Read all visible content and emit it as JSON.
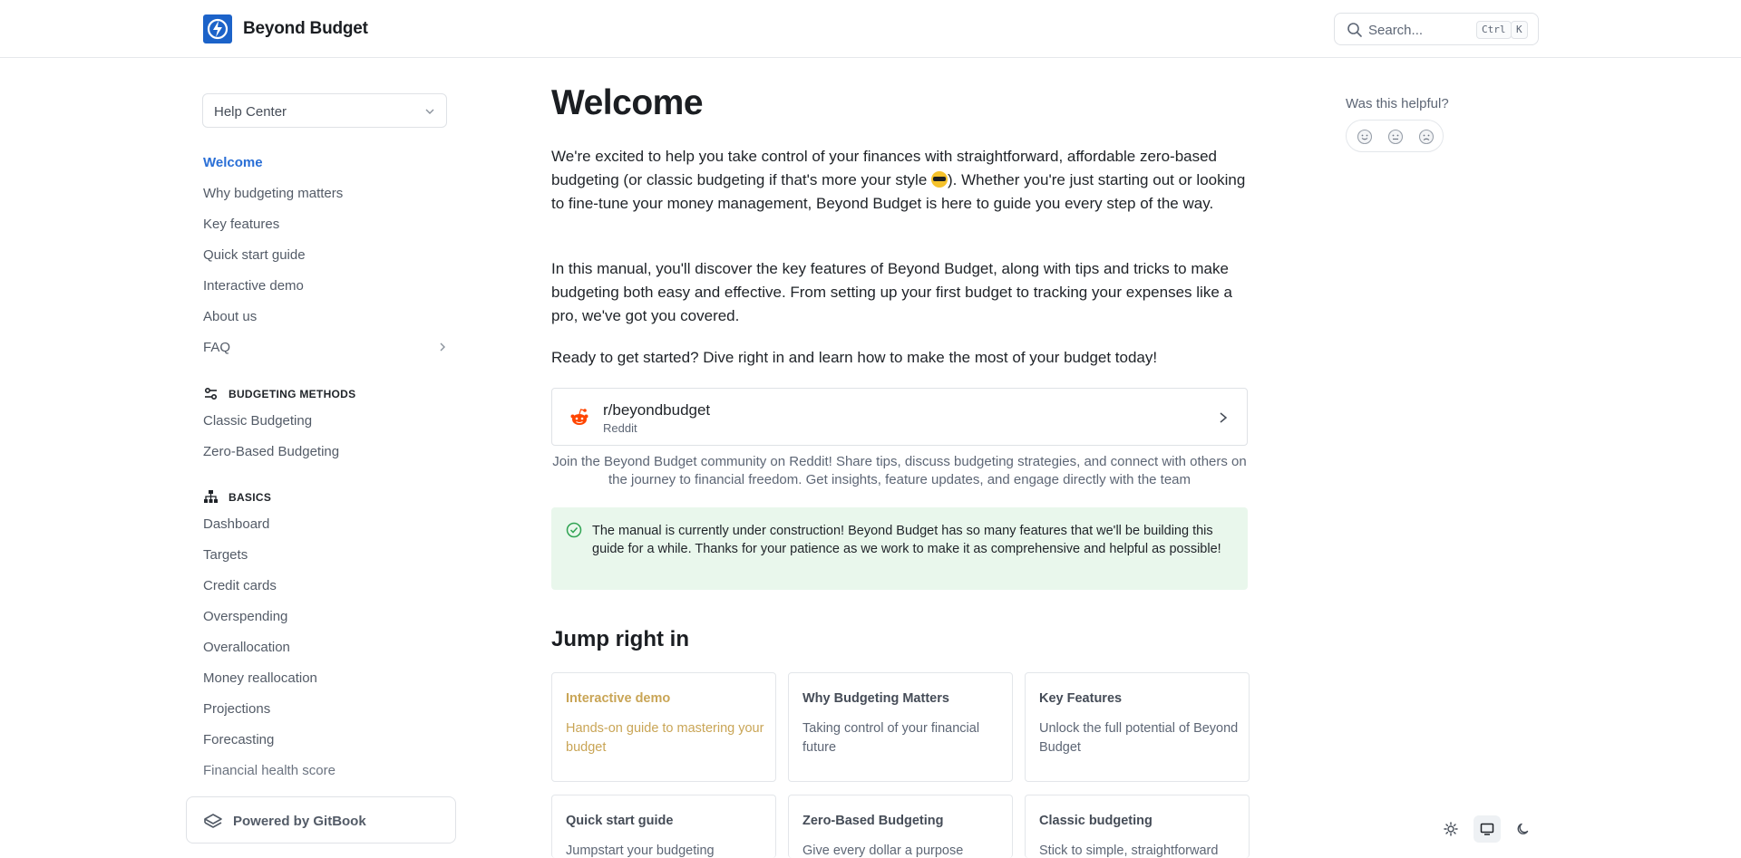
{
  "header": {
    "brand": "Beyond Budget",
    "search": {
      "placeholder": "Search...",
      "shortcut_ctrl": "Ctrl",
      "shortcut_key": "K"
    }
  },
  "sidebar": {
    "space_selector": "Help Center",
    "items": [
      {
        "label": "Welcome",
        "active": true
      },
      {
        "label": "Why budgeting matters"
      },
      {
        "label": "Key features"
      },
      {
        "label": "Quick start guide"
      },
      {
        "label": "Interactive demo"
      },
      {
        "label": "About us"
      },
      {
        "label": "FAQ"
      }
    ],
    "sections": [
      {
        "title": "BUDGETING METHODS",
        "icon": "sliders-icon",
        "items": [
          "Classic Budgeting",
          "Zero-Based Budgeting"
        ]
      },
      {
        "title": "BASICS",
        "icon": "hierarchy-icon",
        "items": [
          "Dashboard",
          "Targets",
          "Credit cards",
          "Overspending",
          "Overallocation",
          "Money reallocation",
          "Projections",
          "Forecasting",
          "Financial health score"
        ]
      }
    ],
    "powered_by": "Powered by GitBook"
  },
  "main": {
    "title": "Welcome",
    "para1_a": "We're excited to help you take control of your finances with straightforward, affordable zero-based budgeting (or classic budgeting if that's more your style ",
    "para1_b": "). Whether you're just starting out or looking to fine-tune your money management, Beyond Budget is here to guide you every step of the way.",
    "para2": "In this manual, you'll discover the key features of Beyond Budget, along with tips and tricks to make budgeting both easy and effective. From setting up your first budget to tracking your expenses like a pro, we've got you covered.",
    "para3": "Ready to get started? Dive right in and learn how to make the most of your budget today!",
    "link_card": {
      "title": "r/beyondbudget",
      "subtitle": "Reddit"
    },
    "link_caption": "Join the Beyond Budget community on Reddit! Share tips, discuss budgeting strategies, and connect with others on the journey to financial freedom. Get insights, feature updates, and engage directly with the team",
    "hint": "The manual is currently under construction! Beyond Budget has so many features that we'll be building this guide for a while. Thanks for your patience as we work to make it as comprehensive and helpful as possible!",
    "jump_heading": "Jump right in",
    "cards": [
      {
        "title": "Interactive demo",
        "desc": "Hands-on guide to mastering your budget"
      },
      {
        "title": "Why Budgeting Matters",
        "desc": "Taking control of your financial future"
      },
      {
        "title": "Key Features",
        "desc": "Unlock the full potential of Beyond Budget"
      },
      {
        "title": "Quick start guide",
        "desc": "Jumpstart your budgeting"
      },
      {
        "title": "Zero-Based Budgeting",
        "desc": "Give every dollar a purpose"
      },
      {
        "title": "Classic budgeting",
        "desc": "Stick to simple, straightforward"
      }
    ]
  },
  "feedback": {
    "question": "Was this helpful?"
  },
  "colors": {
    "accent": "#2a6fd6",
    "brand": "#1c63c9",
    "hint_bg": "#e9f7ec",
    "hint_icon": "#2fa352",
    "demo_card": "#c9a556"
  },
  "theme_toggle": {
    "options": [
      "sun-icon",
      "monitor-icon",
      "moon-icon"
    ],
    "selected": "monitor-icon"
  }
}
